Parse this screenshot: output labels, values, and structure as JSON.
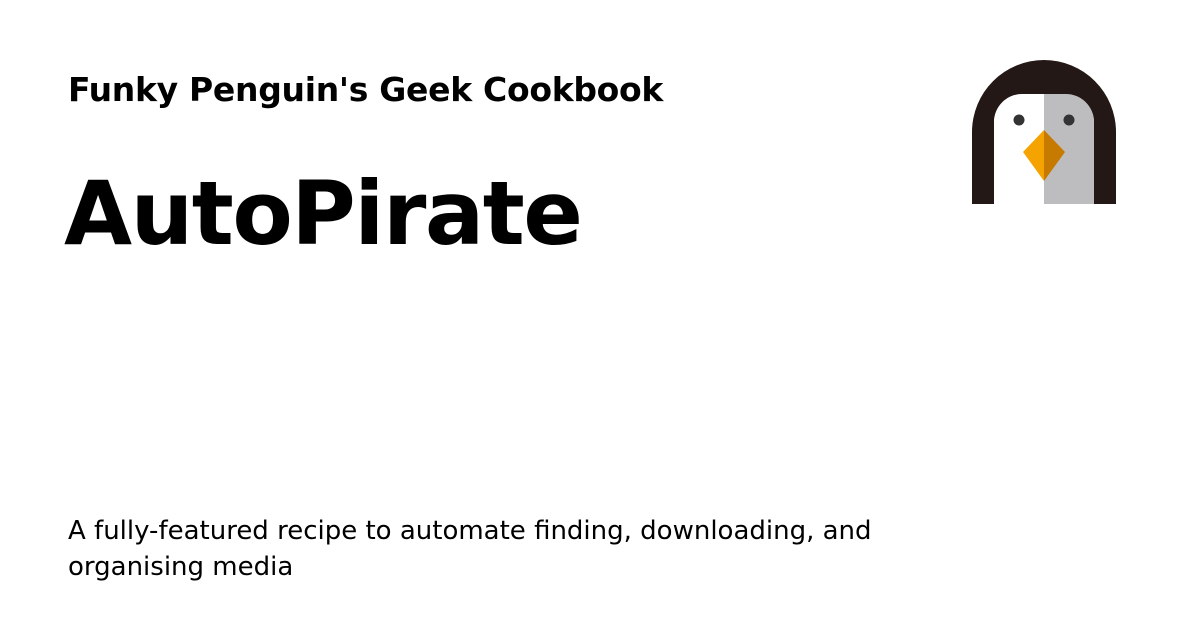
{
  "card": {
    "site_name": "Funky Penguin's Geek Cookbook",
    "title": "AutoPirate",
    "description": "A fully-featured recipe to automate finding, downloading, and organising media"
  },
  "logo": {
    "icon": "penguin-logo-icon",
    "colors": {
      "body": "#231815",
      "face_left": "#ffffff",
      "face_right": "#bdbdbf",
      "eye": "#333333",
      "beak_light": "#f5a300",
      "beak_dark": "#c67a00"
    }
  },
  "colors": {
    "background": "#ffffff",
    "text": "#000000"
  }
}
